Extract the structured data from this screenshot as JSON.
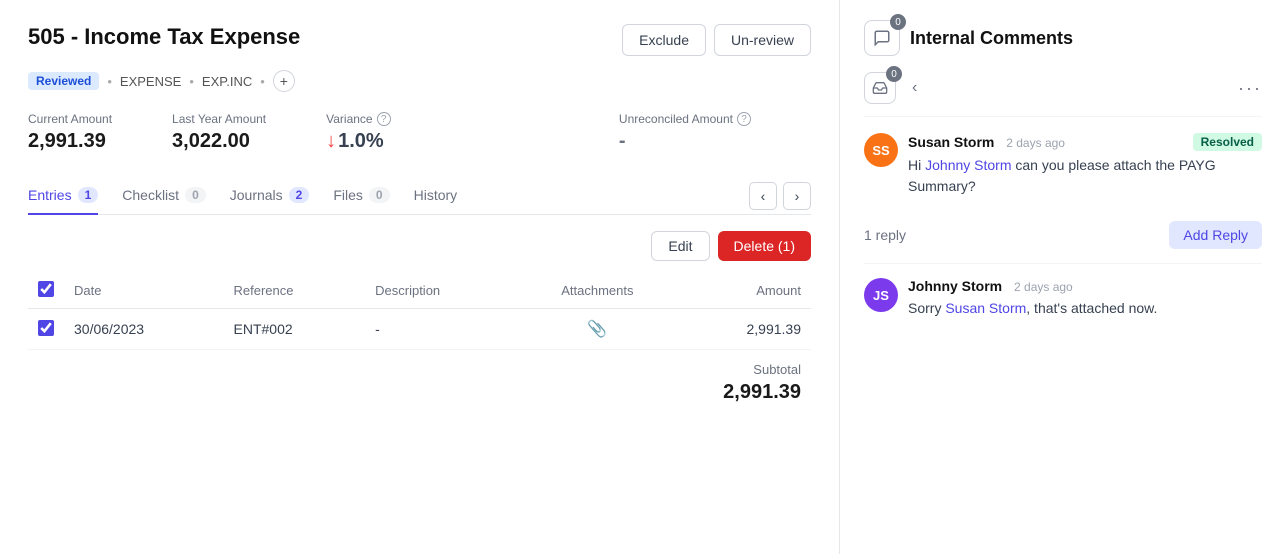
{
  "page": {
    "title": "505 - Income Tax Expense",
    "badge": "Reviewed",
    "meta": [
      "EXPENSE",
      "EXP.INC"
    ],
    "actions": {
      "exclude": "Exclude",
      "unreview": "Un-review"
    }
  },
  "stats": {
    "current_amount_label": "Current Amount",
    "current_amount_value": "2,991.39",
    "last_year_label": "Last Year Amount",
    "last_year_value": "3,022.00",
    "variance_label": "Variance",
    "variance_value": "1.0%",
    "unreconciled_label": "Unreconciled Amount",
    "unreconciled_value": "-"
  },
  "tabs": [
    {
      "label": "Entries",
      "count": "1",
      "active": true
    },
    {
      "label": "Checklist",
      "count": "0",
      "active": false
    },
    {
      "label": "Journals",
      "count": "2",
      "active": false
    },
    {
      "label": "Files",
      "count": "0",
      "active": false
    },
    {
      "label": "History",
      "count": "",
      "active": false
    }
  ],
  "table": {
    "edit_label": "Edit",
    "delete_label": "Delete (1)",
    "columns": [
      "Date",
      "Reference",
      "Description",
      "Attachments",
      "Amount"
    ],
    "rows": [
      {
        "date": "30/06/2023",
        "reference": "ENT#002",
        "description": "-",
        "has_attachment": true,
        "amount": "2,991.39"
      }
    ],
    "subtotal_label": "Subtotal",
    "subtotal_value": "2,991.39"
  },
  "comments": {
    "title": "Internal Comments",
    "icon_badge": "0",
    "inbox_badge": "0",
    "items": [
      {
        "author": "Susan Storm",
        "time": "2 days ago",
        "resolved": true,
        "resolved_label": "Resolved",
        "text_before": "Hi ",
        "mention": "Johnny Storm",
        "text_after": " can you please attach the PAYG Summary?",
        "avatar_initials": "SS",
        "avatar_color": "#f97316"
      }
    ],
    "reply_count": "1 reply",
    "add_reply_label": "Add Reply",
    "reply_author": "Johnny Storm",
    "reply_time": "2 days ago",
    "reply_text_before": "Sorry ",
    "reply_mention": "Susan Storm",
    "reply_text_after": ", that's attached now.",
    "reply_avatar_color": "#7c3aed",
    "reply_avatar_initials": "JS"
  }
}
